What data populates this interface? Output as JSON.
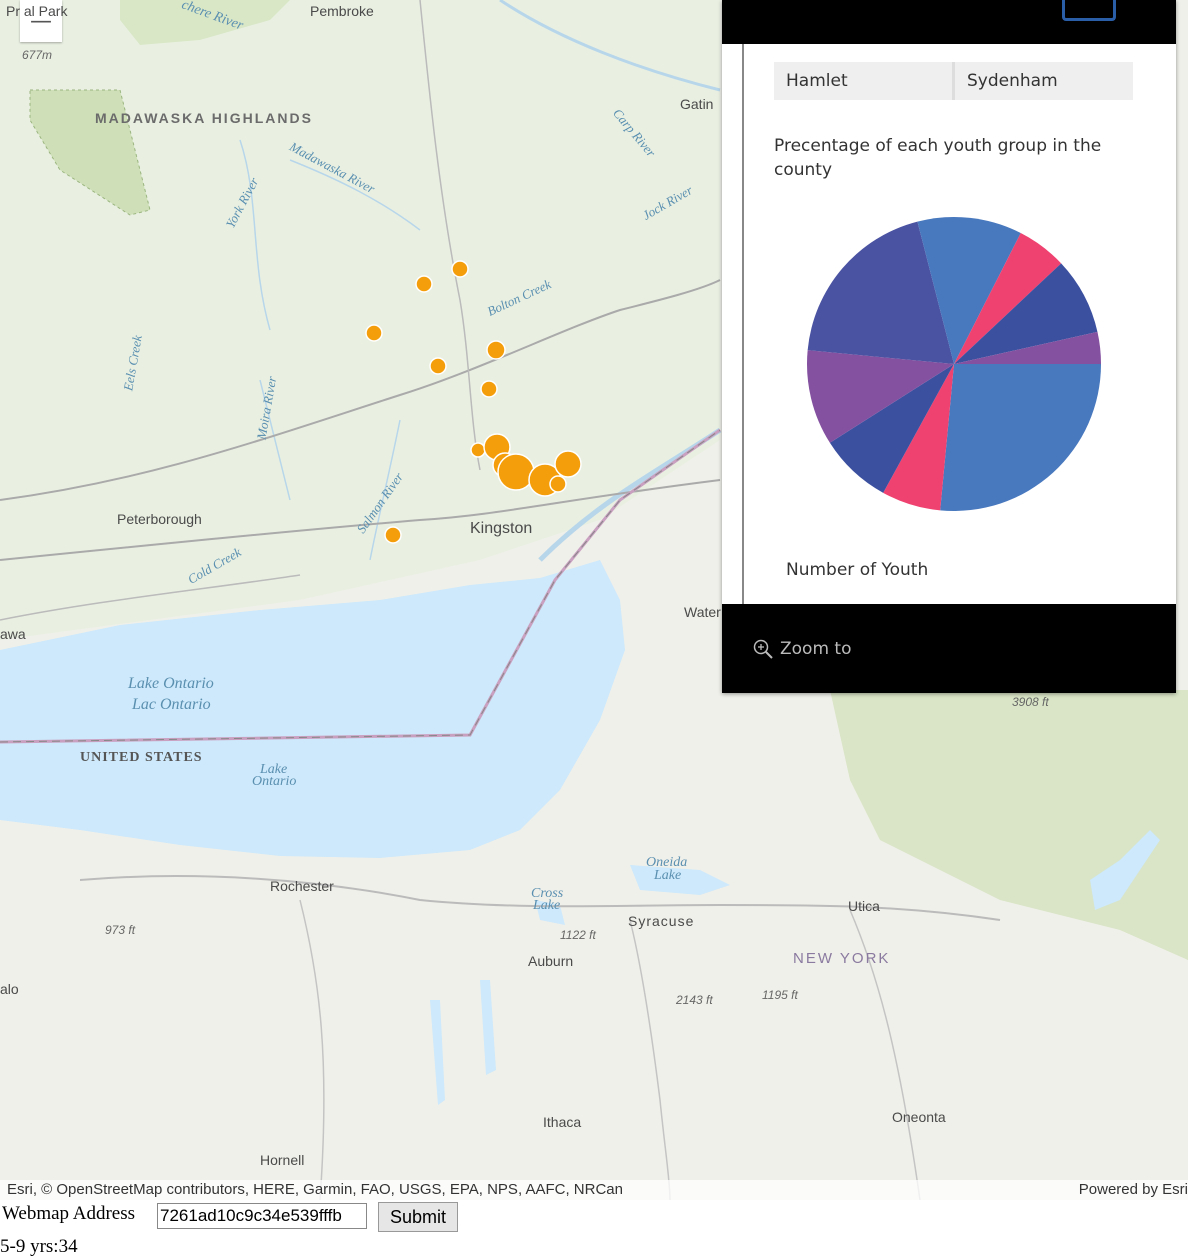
{
  "map": {
    "zoom_out": "—",
    "labels": {
      "park": "Pr     al Park",
      "pembroke": "Pembroke",
      "elev_677": "677m",
      "madawaska_highlands": "MADAWASKA HIGHLANDS",
      "gatin": "Gatin",
      "peterborough": "Peterborough",
      "kingston": "Kingston",
      "watertown": "Water",
      "awa": "awa",
      "lake_ontario_en": "Lake Ontario",
      "lake_ontario_fr": "Lac Ontario",
      "united_states": "UNITED STATES",
      "lake_ontario_2": "Lake",
      "lake_ontario_2b": "Ontario",
      "oneida_lake": "Oneida",
      "oneida_lake_b": "Lake",
      "rochester": "Rochester",
      "cross_lake": "Cross",
      "cross_lake_b": "Lake",
      "syracuse": "Syracuse",
      "utica": "Utica",
      "elev_973": "973 ft",
      "elev_1122": "1122 ft",
      "auburn": "Auburn",
      "new_york": "NEW YORK",
      "elev_2143": "2143 ft",
      "elev_1195": "1195 ft",
      "elev_3908": "3908 ft",
      "alo": "alo",
      "ithaca": "Ithaca",
      "oneonta": "Oneonta",
      "hornell": "Hornell",
      "bolton_creek": "Bolton Creek",
      "salmon_river": "Salmon River",
      "cold_creek": "Cold Creek",
      "moira_river": "Moira River",
      "eels_creek": "Eels Creek",
      "york_river": "York River",
      "madawaska_river": "Madawaska River",
      "carp_river": "Carp River",
      "jock_river": "Jock River",
      "petawawa_river": "chere River"
    },
    "attribution": "Esri, © OpenStreetMap contributors, HERE, Garmin, FAO, USGS, EPA, NPS, AAFC, NRCan",
    "powered_by": "Powered by Esri",
    "marker_color": "#f59e0b"
  },
  "popup": {
    "field_name": "Hamlet",
    "field_value": "Sydenham",
    "chart_title": "Precentage of each youth group in the county",
    "chart_label": "Number of Youth",
    "zoom_to": "Zoom to"
  },
  "chart_data": {
    "type": "pie",
    "title": "Precentage of each youth group in the county",
    "xlabel": "Number of Youth",
    "slices": [
      {
        "value": 26.5,
        "color": "#4878be"
      },
      {
        "value": 6.5,
        "color": "#ef4270"
      },
      {
        "value": 8.0,
        "color": "#3c50a0"
      },
      {
        "value": 10.5,
        "color": "#8451a0"
      },
      {
        "value": 19.5,
        "color": "#4a52a2"
      },
      {
        "value": 11.5,
        "color": "#4878be"
      },
      {
        "value": 5.5,
        "color": "#ef4270"
      },
      {
        "value": 8.5,
        "color": "#3c50a0"
      },
      {
        "value": 3.5,
        "color": "#8451a0"
      }
    ]
  },
  "form": {
    "label": "Webmap Address",
    "input_value": "7261ad10c9c34e539fffb",
    "submit_label": "Submit",
    "output": "5-9 yrs:34"
  }
}
